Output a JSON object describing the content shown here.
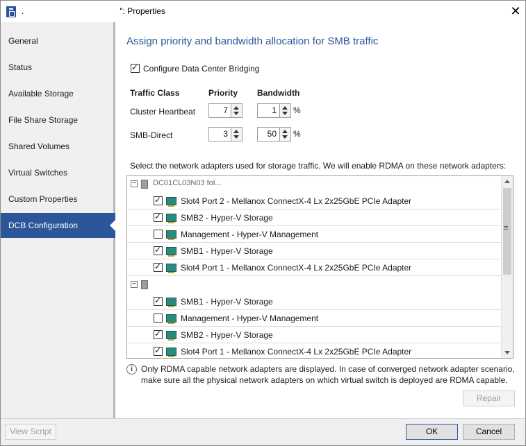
{
  "window": {
    "title_prefix": ".",
    "title_suffix": "\": Properties",
    "close_glyph": "✕"
  },
  "sidebar": {
    "items": [
      {
        "label": "General",
        "active": false
      },
      {
        "label": "Status",
        "active": false
      },
      {
        "label": "Available Storage",
        "active": false
      },
      {
        "label": "File Share Storage",
        "active": false
      },
      {
        "label": "Shared Volumes",
        "active": false
      },
      {
        "label": "Virtual Switches",
        "active": false
      },
      {
        "label": "Custom Properties",
        "active": false
      },
      {
        "label": "DCB Configuration",
        "active": true
      }
    ]
  },
  "main": {
    "heading": "Assign priority and bandwidth allocation for SMB traffic",
    "dcb_checkbox": {
      "label": "Configure Data Center Bridging",
      "checked": true
    },
    "table": {
      "headers": [
        "Traffic Class",
        "Priority",
        "Bandwidth"
      ],
      "rows": [
        {
          "class": "Cluster Heartbeat",
          "priority": "7",
          "bandwidth": "1",
          "unit": "%"
        },
        {
          "class": "SMB-Direct",
          "priority": "3",
          "bandwidth": "50",
          "unit": "%"
        }
      ]
    },
    "select_text": "Select the network adapters used for storage traffic. We will enable RDMA on these network adapters:",
    "groups": [
      {
        "name": "DC01CL03N03 fol...",
        "toggle": "−",
        "adapters": [
          {
            "label": "Slot4 Port 2 - Mellanox ConnectX-4 Lx 2x25GbE PCIe Adapter",
            "checked": true
          },
          {
            "label": "SMB2 - Hyper-V Storage",
            "checked": true
          },
          {
            "label": "Management - Hyper-V Management",
            "checked": false
          },
          {
            "label": "SMB1 - Hyper-V Storage",
            "checked": true
          },
          {
            "label": "Slot4 Port 1 - Mellanox ConnectX-4 Lx 2x25GbE PCIe Adapter",
            "checked": true
          }
        ]
      },
      {
        "name": "",
        "toggle": "−",
        "adapters": [
          {
            "label": "SMB1 - Hyper-V Storage",
            "checked": true
          },
          {
            "label": "Management - Hyper-V Management",
            "checked": false
          },
          {
            "label": "SMB2 - Hyper-V Storage",
            "checked": true
          },
          {
            "label": "Slot4 Port 1 - Mellanox ConnectX-4 Lx 2x25GbE PCIe Adapter",
            "checked": true
          }
        ]
      }
    ],
    "info_icon": "i",
    "info_text": "Only RDMA capable network adapters are displayed. In case of converged network adapter scenario, make sure all the physical network adapters on which virtual switch is deployed are RDMA capable.",
    "repair_label": "Repair"
  },
  "footer": {
    "view_script_label": "View Script",
    "ok_label": "OK",
    "cancel_label": "Cancel"
  },
  "colors": {
    "accent": "#2b579a",
    "sidebar_bg": "#f0f0f0"
  }
}
